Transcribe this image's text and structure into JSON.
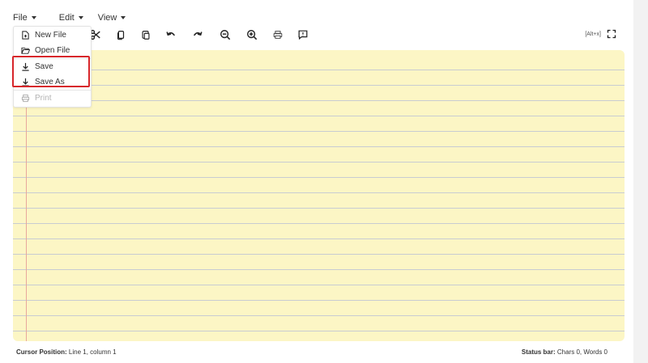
{
  "menubar": {
    "file": "File",
    "edit": "Edit",
    "view": "View"
  },
  "file_menu": {
    "items": [
      {
        "label": "New File",
        "icon": "file-plus-icon",
        "enabled": true
      },
      {
        "label": "Open File",
        "icon": "folder-open-icon",
        "enabled": true
      },
      {
        "label": "Save",
        "icon": "download-icon",
        "enabled": true
      },
      {
        "label": "Save As",
        "icon": "download-icon",
        "enabled": true
      },
      {
        "label": "Print",
        "icon": "printer-icon",
        "enabled": false
      }
    ]
  },
  "toolbar": {
    "buttons": [
      "cut-icon",
      "copy-icon",
      "paste-icon",
      "undo-icon",
      "redo-icon",
      "zoom-out-icon",
      "zoom-in-icon",
      "print-icon",
      "comment-icon"
    ],
    "shortcut_hint": "[Alt+x]",
    "fullscreen_icon": "fullscreen-icon"
  },
  "statusbar": {
    "cursor_label": "Cursor Position:",
    "cursor_value": " Line 1, column 1",
    "status_label": "Status bar:",
    "status_value": " Chars 0, Words 0"
  },
  "colors": {
    "paper": "#fcf6c5",
    "rule_line": "#c8ccd2",
    "margin_line": "#e8a89c",
    "highlight": "#d7262b"
  }
}
